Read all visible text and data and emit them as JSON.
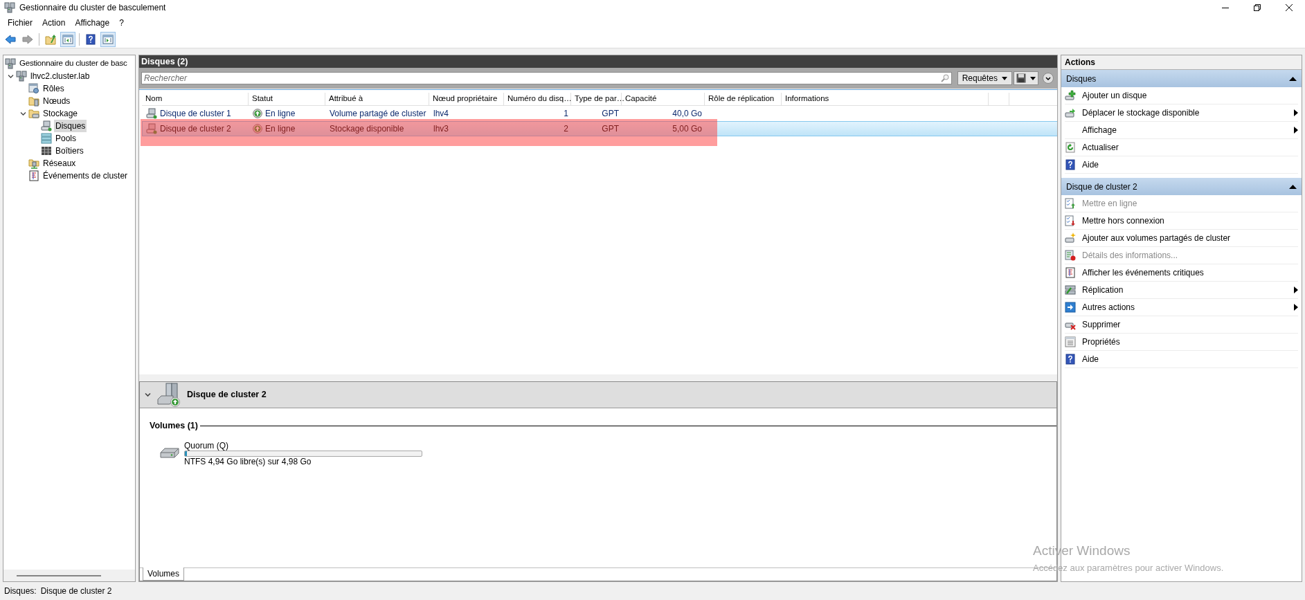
{
  "window": {
    "title": "Gestionnaire du cluster de basculement"
  },
  "menu": [
    "Fichier",
    "Action",
    "Affichage",
    "?"
  ],
  "toolbar": [
    {
      "pressed": false,
      "disabled": false
    },
    {
      "pressed": false,
      "disabled": true
    },
    {
      "pressed": false,
      "disabled": false
    },
    {
      "pressed": true,
      "disabled": false
    },
    {
      "pressed": false,
      "disabled": false
    },
    {
      "pressed": true,
      "disabled": false
    }
  ],
  "tree": [
    {
      "label": "Gestionnaire du cluster de basc",
      "selected": false,
      "children": [
        {
          "label": "lhvc2.cluster.lab",
          "selected": false,
          "expanded": true,
          "children": [
            {
              "label": "Rôles",
              "selected": false
            },
            {
              "label": "Nœuds",
              "selected": false
            },
            {
              "label": "Stockage",
              "selected": false,
              "expanded": true,
              "children": [
                {
                  "label": "Disques",
                  "selected": true
                },
                {
                  "label": "Pools",
                  "selected": false
                },
                {
                  "label": "Boîtiers",
                  "selected": false
                }
              ]
            },
            {
              "label": "Réseaux",
              "selected": false
            },
            {
              "label": "Événements de cluster",
              "selected": false
            }
          ]
        }
      ]
    }
  ],
  "list": {
    "title": "Disques (2)",
    "search": {
      "placeholder": "Rechercher"
    },
    "queries_button": "Requêtes",
    "columns": [
      "Nom",
      "Statut",
      "Attribué à",
      "Nœud propriétaire",
      "Numéro du disq…",
      "Type de par…",
      "Capacité",
      "Rôle de réplication",
      "Informations"
    ],
    "rows": [
      {
        "selected": false,
        "highlighted": false,
        "cells": [
          "Disque de cluster 1",
          "En ligne",
          "Volume partagé de cluster",
          "lhv4",
          "1",
          "GPT",
          "40,0 Go",
          "",
          ""
        ]
      },
      {
        "selected": true,
        "highlighted": true,
        "cells": [
          "Disque de cluster 2",
          "En ligne",
          "Stockage disponible",
          "lhv3",
          "2",
          "GPT",
          "5,00 Go",
          "",
          ""
        ]
      }
    ]
  },
  "details": {
    "title": "Disque de cluster 2",
    "expanded": true,
    "section": "Volumes (1)",
    "volumes": [
      {
        "name": "Quorum (Q)",
        "level": 0.01,
        "info": "NTFS 4,94 Go libre(s) sur 4,98 Go"
      }
    ],
    "tabs": [
      {
        "label": "Volumes",
        "selected": true
      }
    ]
  },
  "actions": {
    "title": "Actions",
    "sections": [
      {
        "title": "Disques",
        "expanded": true,
        "items": [
          {
            "label": "Ajouter un disque",
            "disabled": false,
            "submenu": false
          },
          {
            "label": "Déplacer le stockage disponible",
            "disabled": false,
            "submenu": true
          },
          {
            "label": "Affichage",
            "disabled": false,
            "submenu": true
          },
          {
            "label": "Actualiser",
            "disabled": false,
            "submenu": false
          },
          {
            "label": "Aide",
            "disabled": false,
            "submenu": false
          }
        ]
      },
      {
        "title": "Disque de cluster 2",
        "expanded": true,
        "items": [
          {
            "label": "Mettre en ligne",
            "disabled": true,
            "submenu": false
          },
          {
            "label": "Mettre hors connexion",
            "disabled": false,
            "submenu": false
          },
          {
            "label": "Ajouter aux volumes partagés de cluster",
            "disabled": false,
            "submenu": false
          },
          {
            "label": "Détails des informations...",
            "disabled": true,
            "submenu": false
          },
          {
            "label": "Afficher les événements critiques",
            "disabled": false,
            "submenu": false
          },
          {
            "label": "Réplication",
            "disabled": false,
            "submenu": true
          },
          {
            "label": "Autres actions",
            "disabled": false,
            "submenu": true
          },
          {
            "label": "Supprimer",
            "disabled": false,
            "submenu": false
          },
          {
            "label": "Propriétés",
            "disabled": false,
            "submenu": false
          },
          {
            "label": "Aide",
            "disabled": false,
            "submenu": false
          }
        ]
      }
    ]
  },
  "status_bar": {
    "label": "Disques:",
    "value": "Disque de cluster 2"
  },
  "activation_notice": {
    "title": "Activer Windows",
    "message": "Accédez aux paramètres pour activer Windows."
  }
}
